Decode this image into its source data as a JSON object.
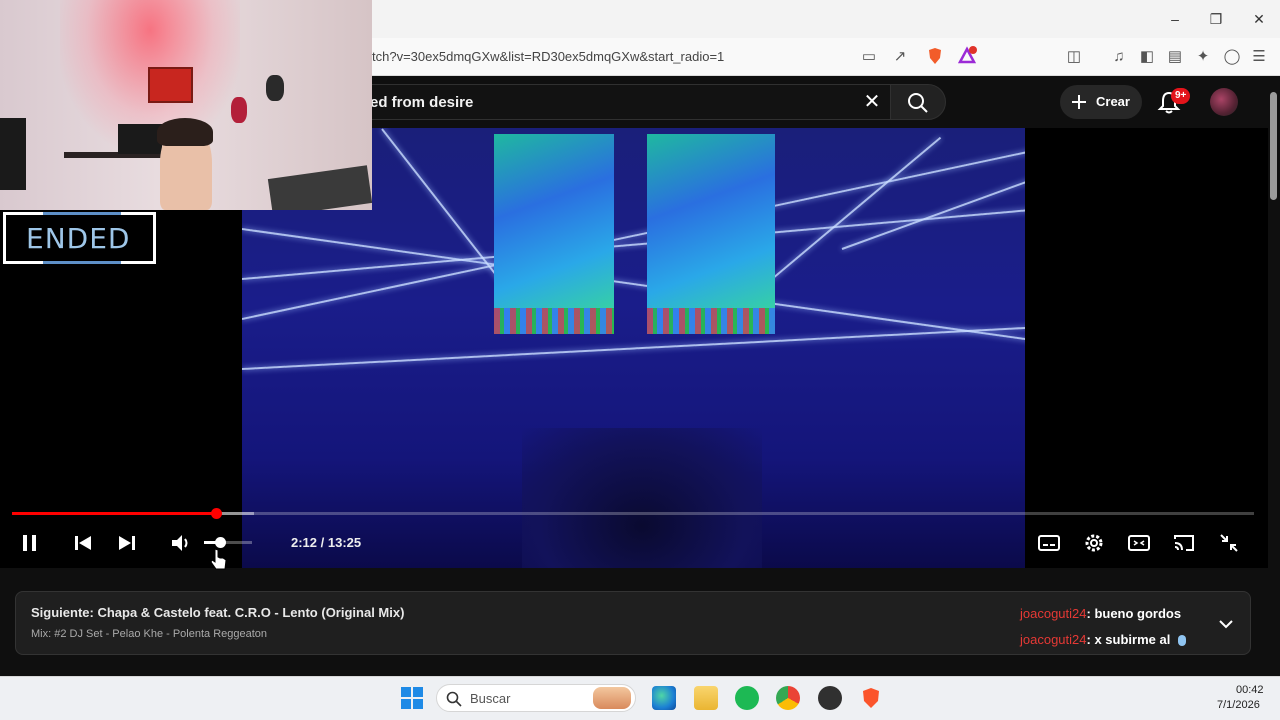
{
  "browser": {
    "url": "tch?v=30ex5dmqGXw&list=RD30ex5dmqGXw&start_radio=1",
    "window_controls": [
      "minimize",
      "restore",
      "close"
    ]
  },
  "header": {
    "search_query": "ed from desire",
    "create_label": "Crear",
    "notifications_badge": "9+"
  },
  "player": {
    "time_current": "2:12",
    "time_total": "13:25",
    "time_display": "2:12 / 13:25",
    "progress_fraction": 0.164,
    "volume_fraction": 0.33,
    "status": "playing"
  },
  "up_next": {
    "title": "Siguiente: Chapa & Castelo feat. C.R.O - Lento (Original Mix)",
    "subtitle": "Mix: #2 DJ Set - Pelao Khe - Polenta Reggeaton"
  },
  "chat": [
    {
      "user": "joacoguti24",
      "message": ": bueno gordos"
    },
    {
      "user": "joacoguti24",
      "message": ": x subirme al"
    }
  ],
  "overlay": {
    "ended_label": "ENDED"
  },
  "taskbar": {
    "search_placeholder": "Buscar",
    "time": "00:42",
    "date": "7/1/2026"
  },
  "colors": {
    "progress_red": "#ff0000",
    "chat_user": "#e53935",
    "ended_text": "#9ec6e8"
  }
}
